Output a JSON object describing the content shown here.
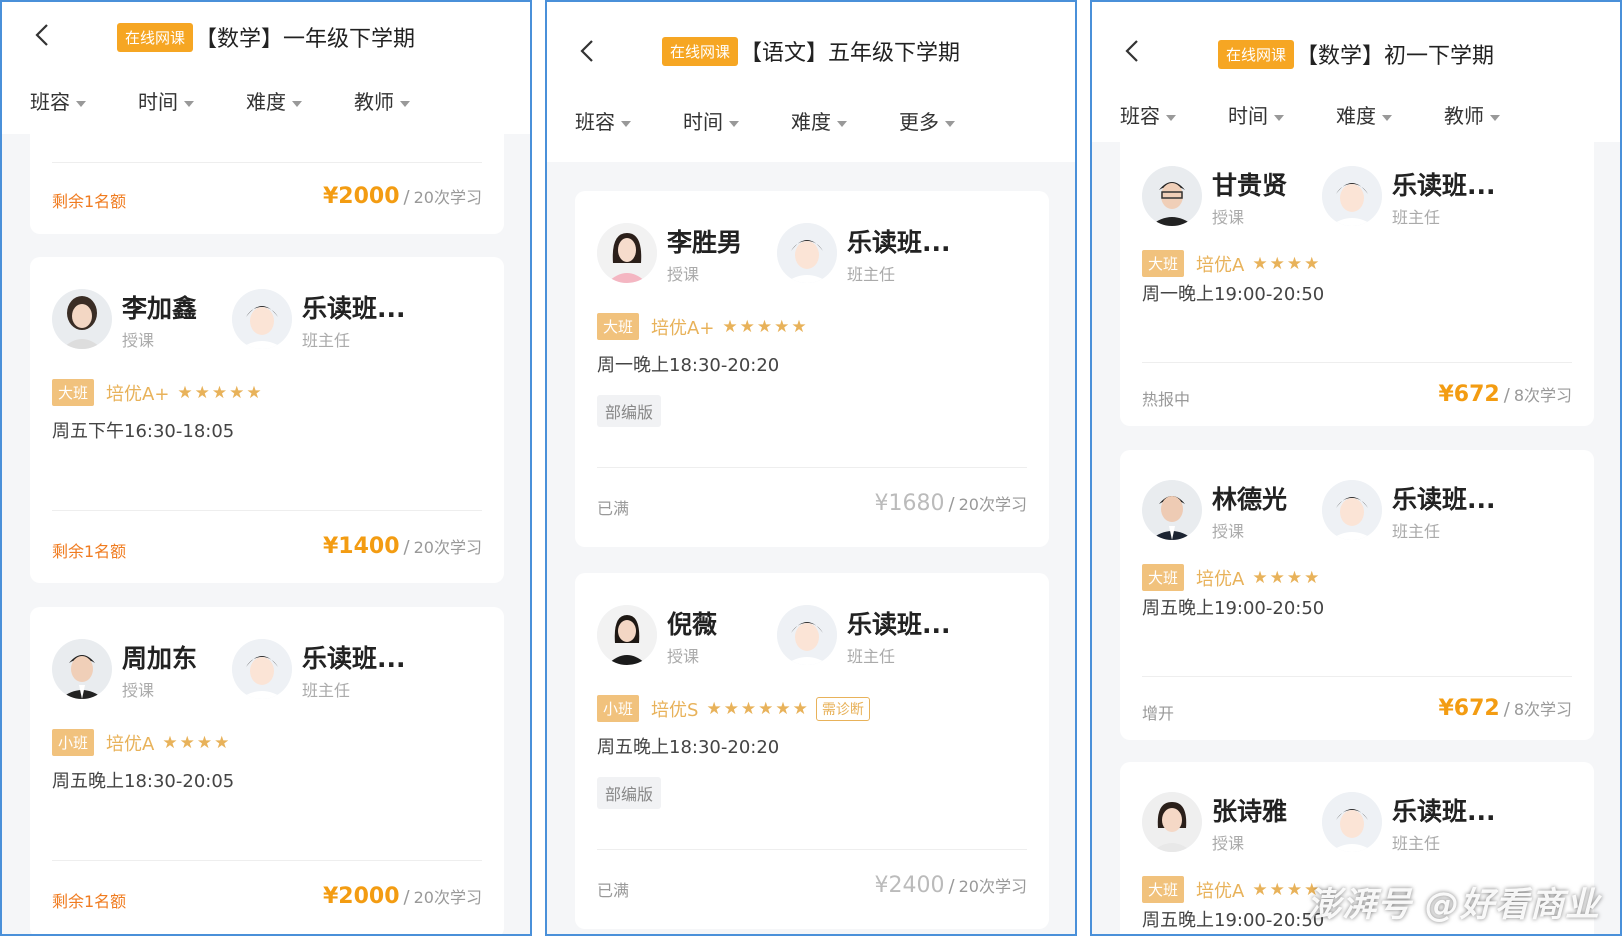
{
  "panels": [
    {
      "online_badge": "在线网课",
      "title": "【数学】一年级下学期",
      "filters": [
        "班容",
        "时间",
        "难度",
        "教师"
      ],
      "top_card": {
        "status": "剩余1名额",
        "price": "¥2000",
        "sessions": "20次学习"
      },
      "cards": [
        {
          "teacher": "李加鑫",
          "teacher_role": "授课",
          "head": "乐读班...",
          "head_role": "班主任",
          "size": "大班",
          "level": "培优A+",
          "stars": "★★★★★",
          "schedule": "周五下午16:30-18:05",
          "status": "剩余1名额",
          "price": "¥1400",
          "sessions": "20次学习"
        },
        {
          "teacher": "周加东",
          "teacher_role": "授课",
          "head": "乐读班...",
          "head_role": "班主任",
          "size": "小班",
          "level": "培优A",
          "stars": "★★★★",
          "schedule": "周五晚上18:30-20:05",
          "status": "剩余1名额",
          "price": "¥2000",
          "sessions": "20次学习"
        }
      ]
    },
    {
      "online_badge": "在线网课",
      "title": "【语文】五年级下学期",
      "filters": [
        "班容",
        "时间",
        "难度",
        "更多"
      ],
      "cards": [
        {
          "teacher": "李胜男",
          "teacher_role": "授课",
          "head": "乐读班...",
          "head_role": "班主任",
          "size": "大班",
          "level": "培优A+",
          "stars": "★★★★★",
          "schedule": "周一晚上18:30-20:20",
          "edition": "部编版",
          "status": "已满",
          "price": "¥1680",
          "sessions": "20次学习"
        },
        {
          "teacher": "倪薇",
          "teacher_role": "授课",
          "head": "乐读班...",
          "head_role": "班主任",
          "size": "小班",
          "level": "培优S",
          "stars": "★★★★★★",
          "diag": "需诊断",
          "schedule": "周五晚上18:30-20:20",
          "edition": "部编版",
          "status": "已满",
          "price": "¥2400",
          "sessions": "20次学习"
        }
      ]
    },
    {
      "online_badge": "在线网课",
      "title": "【数学】初一下学期",
      "filters": [
        "班容",
        "时间",
        "难度",
        "教师"
      ],
      "cards": [
        {
          "teacher": "甘贵贤",
          "teacher_role": "授课",
          "head": "乐读班...",
          "head_role": "班主任",
          "size": "大班",
          "level": "培优A",
          "stars": "★★★★",
          "schedule": "周一晚上19:00-20:50",
          "status": "热报中",
          "price": "¥672",
          "sessions": "8次学习"
        },
        {
          "teacher": "林德光",
          "teacher_role": "授课",
          "head": "乐读班...",
          "head_role": "班主任",
          "size": "大班",
          "level": "培优A",
          "stars": "★★★★",
          "schedule": "周五晚上19:00-20:50",
          "status": "增开",
          "price": "¥672",
          "sessions": "8次学习"
        },
        {
          "teacher": "张诗雅",
          "teacher_role": "授课",
          "head": "乐读班...",
          "head_role": "班主任",
          "size": "大班",
          "level": "培优A",
          "stars": "★★★★",
          "schedule": "周五晚上19:00-20:50"
        }
      ]
    }
  ],
  "watermark": "澎湃号 @好看商业",
  "colors": {
    "accent_orange": "#f6a623",
    "price_orange": "#f39c12",
    "gold": "#e8b25a",
    "frame_blue": "#4a90d9"
  }
}
